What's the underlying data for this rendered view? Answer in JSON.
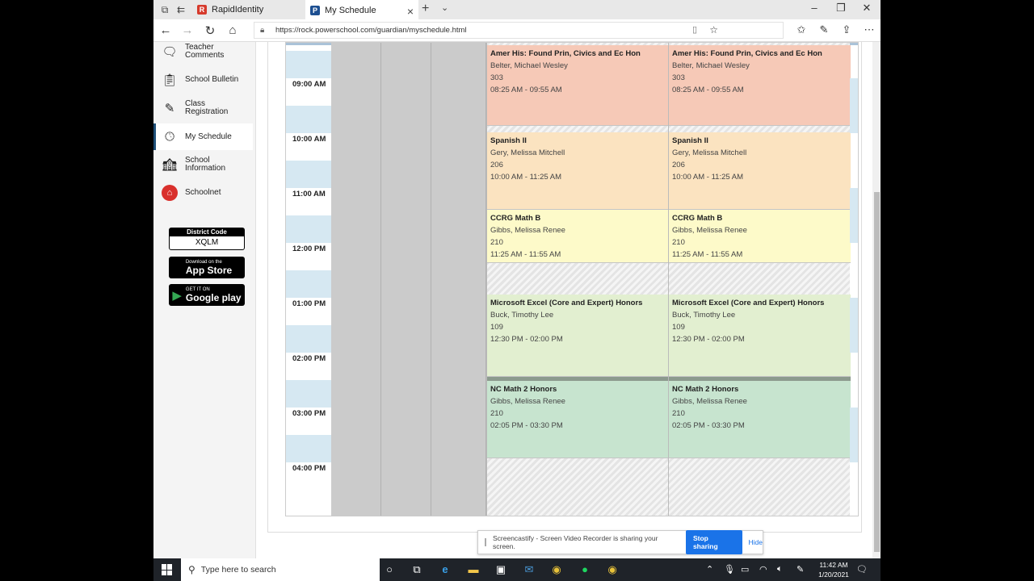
{
  "browser": {
    "tabs": [
      {
        "label": "RapidIdentity",
        "favicon": "rapididentity-icon",
        "active": false
      },
      {
        "label": "My Schedule",
        "favicon": "powerschool-icon",
        "active": true
      }
    ],
    "url": "https://rock.powerschool.com/guardian/myschedule.html"
  },
  "sidebar": {
    "items": [
      {
        "label": "Teacher Comments",
        "icon": "comments-icon"
      },
      {
        "label": "School Bulletin",
        "icon": "bulletin-icon"
      },
      {
        "label": "Class Registration",
        "icon": "registration-icon"
      },
      {
        "label": "My Schedule",
        "icon": "schedule-clock-icon",
        "active": true
      },
      {
        "label": "School Information",
        "icon": "school-building-icon"
      },
      {
        "label": "Schoolnet",
        "icon": "schoolnet-icon"
      }
    ],
    "district_code_label": "District Code",
    "district_code": "XQLM",
    "app_store_small": "Download on the",
    "app_store_big": "App Store",
    "google_play_small": "GET IT ON",
    "google_play_big": "Google play"
  },
  "schedule": {
    "times": [
      "09:00 AM",
      "10:00 AM",
      "11:00 AM",
      "12:00 PM",
      "01:00 PM",
      "02:00 PM",
      "03:00 PM",
      "04:00 PM"
    ],
    "classes": [
      {
        "name": "Amer His: Found Prin, Civics and Ec Hon",
        "teacher": "Belter, Michael Wesley",
        "room": "303",
        "time": "08:25 AM - 09:55 AM",
        "color": "#f6c9b7"
      },
      {
        "name": "Spanish II",
        "teacher": "Gery, Melissa Mitchell",
        "room": "206",
        "time": "10:00 AM - 11:25 AM",
        "color": "#fbe3c0"
      },
      {
        "name": "CCRG Math B",
        "teacher": "Gibbs, Melissa Renee",
        "room": "210",
        "time": "11:25 AM - 11:55 AM",
        "color": "#fdfac9"
      },
      {
        "name": "Microsoft Excel (Core and Expert) Honors",
        "teacher": "Buck, Timothy Lee",
        "room": "109",
        "time": "12:30 PM - 02:00 PM",
        "color": "#e2efd0"
      },
      {
        "name": "NC Math 2 Honors",
        "teacher": "Gibbs, Melissa Renee",
        "room": "210",
        "time": "02:05 PM - 03:30 PM",
        "color": "#c7e4cf"
      }
    ]
  },
  "share_bar": {
    "message": "Screencastify - Screen Video Recorder is sharing your screen.",
    "stop": "Stop sharing",
    "hide": "Hide"
  },
  "taskbar": {
    "search_placeholder": "Type here to search",
    "time": "11:42 AM",
    "date": "1/20/2021"
  }
}
